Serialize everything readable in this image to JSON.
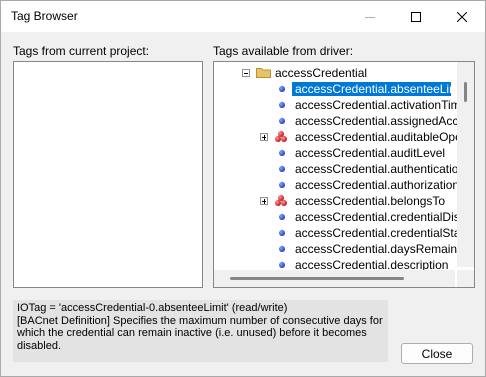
{
  "window": {
    "title": "Tag Browser"
  },
  "labels": {
    "current_project": "Tags from current project:",
    "available_driver": "Tags available from driver:"
  },
  "tree": {
    "root": "accessCredential",
    "items": [
      {
        "label": "accessCredential.absenteeLimit",
        "kind": "property",
        "selected": true
      },
      {
        "label": "accessCredential.activationTime",
        "kind": "property"
      },
      {
        "label": "accessCredential.assignedAccess",
        "kind": "property"
      },
      {
        "label": "accessCredential.auditableOpera",
        "kind": "group"
      },
      {
        "label": "accessCredential.auditLevel",
        "kind": "property"
      },
      {
        "label": "accessCredential.authenticationF",
        "kind": "property"
      },
      {
        "label": "accessCredential.authorizationEx",
        "kind": "property"
      },
      {
        "label": "accessCredential.belongsTo",
        "kind": "group"
      },
      {
        "label": "accessCredential.credentialDisab",
        "kind": "property"
      },
      {
        "label": "accessCredential.credentialStatus",
        "kind": "property"
      },
      {
        "label": "accessCredential.daysRemaining",
        "kind": "property"
      },
      {
        "label": "accessCredential.description",
        "kind": "property"
      }
    ]
  },
  "description": {
    "line1": "IOTag = 'accessCredential-0.absenteeLimit' (read/write)",
    "line2": "[BACnet Definition] Specifies the maximum number of consecutive days for which the credential can remain inactive (i.e. unused) before it becomes disabled."
  },
  "buttons": {
    "close": "Close"
  },
  "colors": {
    "selection": "#0078d7",
    "property_icon": "#1c3ac9",
    "group_icon": "#c81414",
    "folder": "#e8c26a"
  }
}
